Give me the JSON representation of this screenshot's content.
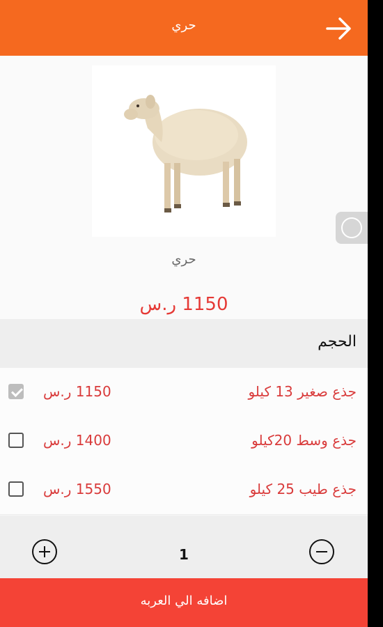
{
  "header": {
    "title": "حري",
    "back_icon": "arrow-right-icon"
  },
  "product": {
    "image": "sheep-photo",
    "name": "حري",
    "price": "1150 ر.س"
  },
  "size_section": {
    "title": "الحجم"
  },
  "options": [
    {
      "name": "جذع صغير 13 كيلو",
      "price": "1150 ر.س",
      "checked": true
    },
    {
      "name": "جذع وسط 20كيلو",
      "price": "1400 ر.س",
      "checked": false
    },
    {
      "name": "جذع طيب  25 كيلو",
      "price": "1550 ر.س",
      "checked": false
    }
  ],
  "quantity": {
    "value": "1",
    "plus_icon": "plus-circle-icon",
    "minus_icon": "minus-circle-icon"
  },
  "add_to_cart": {
    "label": "اضافه الي العربه"
  },
  "colors": {
    "header": "#f5691f",
    "accent": "#f44336",
    "price": "#e53935"
  }
}
